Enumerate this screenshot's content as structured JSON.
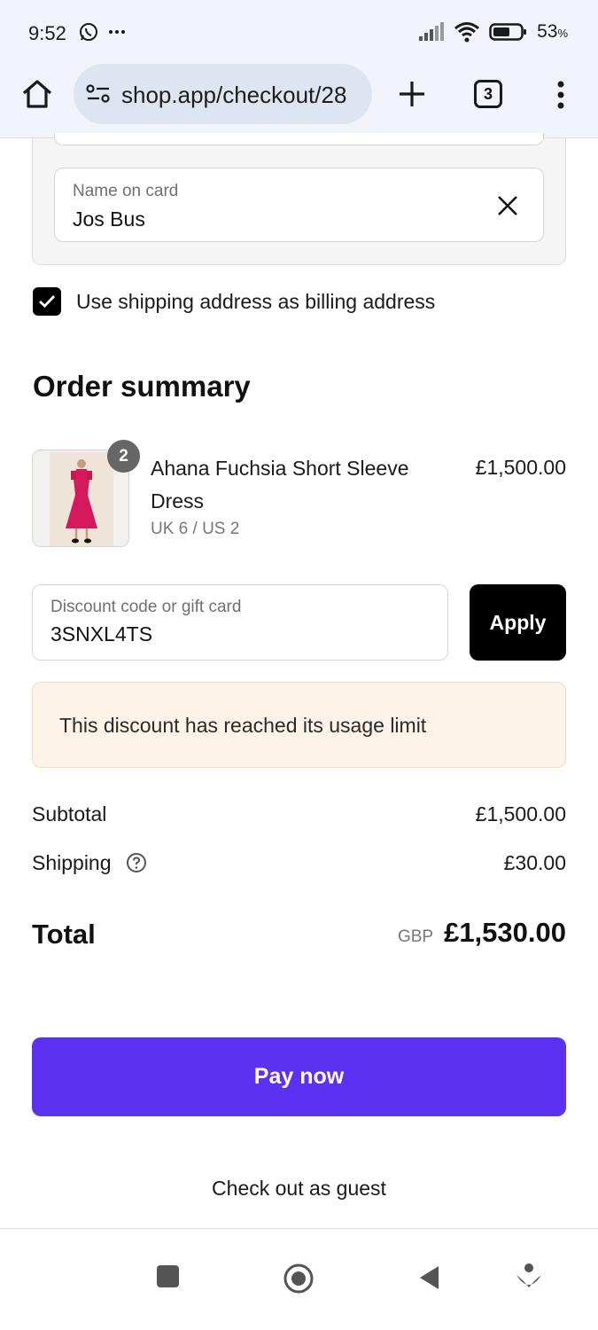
{
  "status_bar": {
    "time": "9:52",
    "battery_percent": "53",
    "battery_unit": "%",
    "icons": [
      "whatsapp-icon",
      "more-dots-icon",
      "signal-icon",
      "wifi-icon",
      "battery-icon"
    ]
  },
  "browser": {
    "url": "shop.app/checkout/28",
    "tab_count": "3",
    "icons": [
      "home-icon",
      "site-settings-icon",
      "new-tab-plus-icon",
      "tabs-counter",
      "overflow-menu-icon"
    ]
  },
  "payment": {
    "name_on_card_label": "Name on card",
    "name_on_card_value": "Jos Bus",
    "billing_checkbox_label": "Use shipping address as billing address",
    "billing_checked": true
  },
  "order_summary": {
    "title": "Order summary",
    "item": {
      "quantity": "2",
      "name": "Ahana Fuchsia Short Sleeve Dress",
      "variant": "UK 6 / US 2",
      "price": "£1,500.00"
    },
    "discount": {
      "label": "Discount code or gift card",
      "value": "3SNXL4TS",
      "apply_label": "Apply",
      "error": "This discount has reached its usage limit"
    },
    "subtotal_label": "Subtotal",
    "subtotal_value": "£1,500.00",
    "shipping_label": "Shipping",
    "shipping_value": "£30.00",
    "total_label": "Total",
    "total_currency": "GBP",
    "total_value": "£1,530.00"
  },
  "actions": {
    "pay_label": "Pay now",
    "guest_label": "Check out as guest"
  },
  "colors": {
    "pay_button": "#5b31f2",
    "alert_bg": "#fdf3e8",
    "browser_bar": "#f1f4fa"
  },
  "nav_bar": {
    "icons": [
      "recents-square-icon",
      "home-circle-icon",
      "back-triangle-icon",
      "assistant-icon"
    ]
  }
}
